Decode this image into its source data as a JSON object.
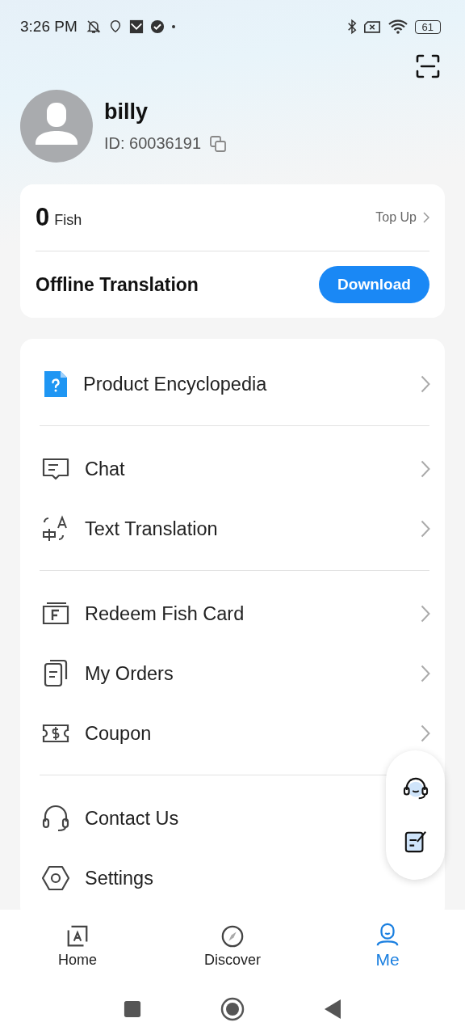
{
  "status_bar": {
    "time": "3:26 PM",
    "battery": "61"
  },
  "profile": {
    "name": "billy",
    "id": "ID: 60036191"
  },
  "wallet": {
    "amount": "0",
    "unit": "Fish",
    "action": "Top Up"
  },
  "offline": {
    "title": "Offline Translation",
    "button": "Download"
  },
  "menu_groups": [
    {
      "items": [
        {
          "label": "Product Encyclopedia",
          "chevron": true
        }
      ]
    },
    {
      "items": [
        {
          "label": "Chat",
          "chevron": true
        },
        {
          "label": "Text Translation",
          "chevron": true
        }
      ]
    },
    {
      "items": [
        {
          "label": "Redeem Fish Card",
          "chevron": true
        },
        {
          "label": "My Orders",
          "chevron": true
        },
        {
          "label": "Coupon",
          "chevron": true
        }
      ]
    },
    {
      "items": [
        {
          "label": "Contact Us",
          "chevron": false
        },
        {
          "label": "Settings",
          "chevron": false
        }
      ]
    }
  ],
  "bottom_nav": [
    {
      "label": "Home",
      "selected": false
    },
    {
      "label": "Discover",
      "selected": false
    },
    {
      "label": "Me",
      "selected": true
    }
  ]
}
